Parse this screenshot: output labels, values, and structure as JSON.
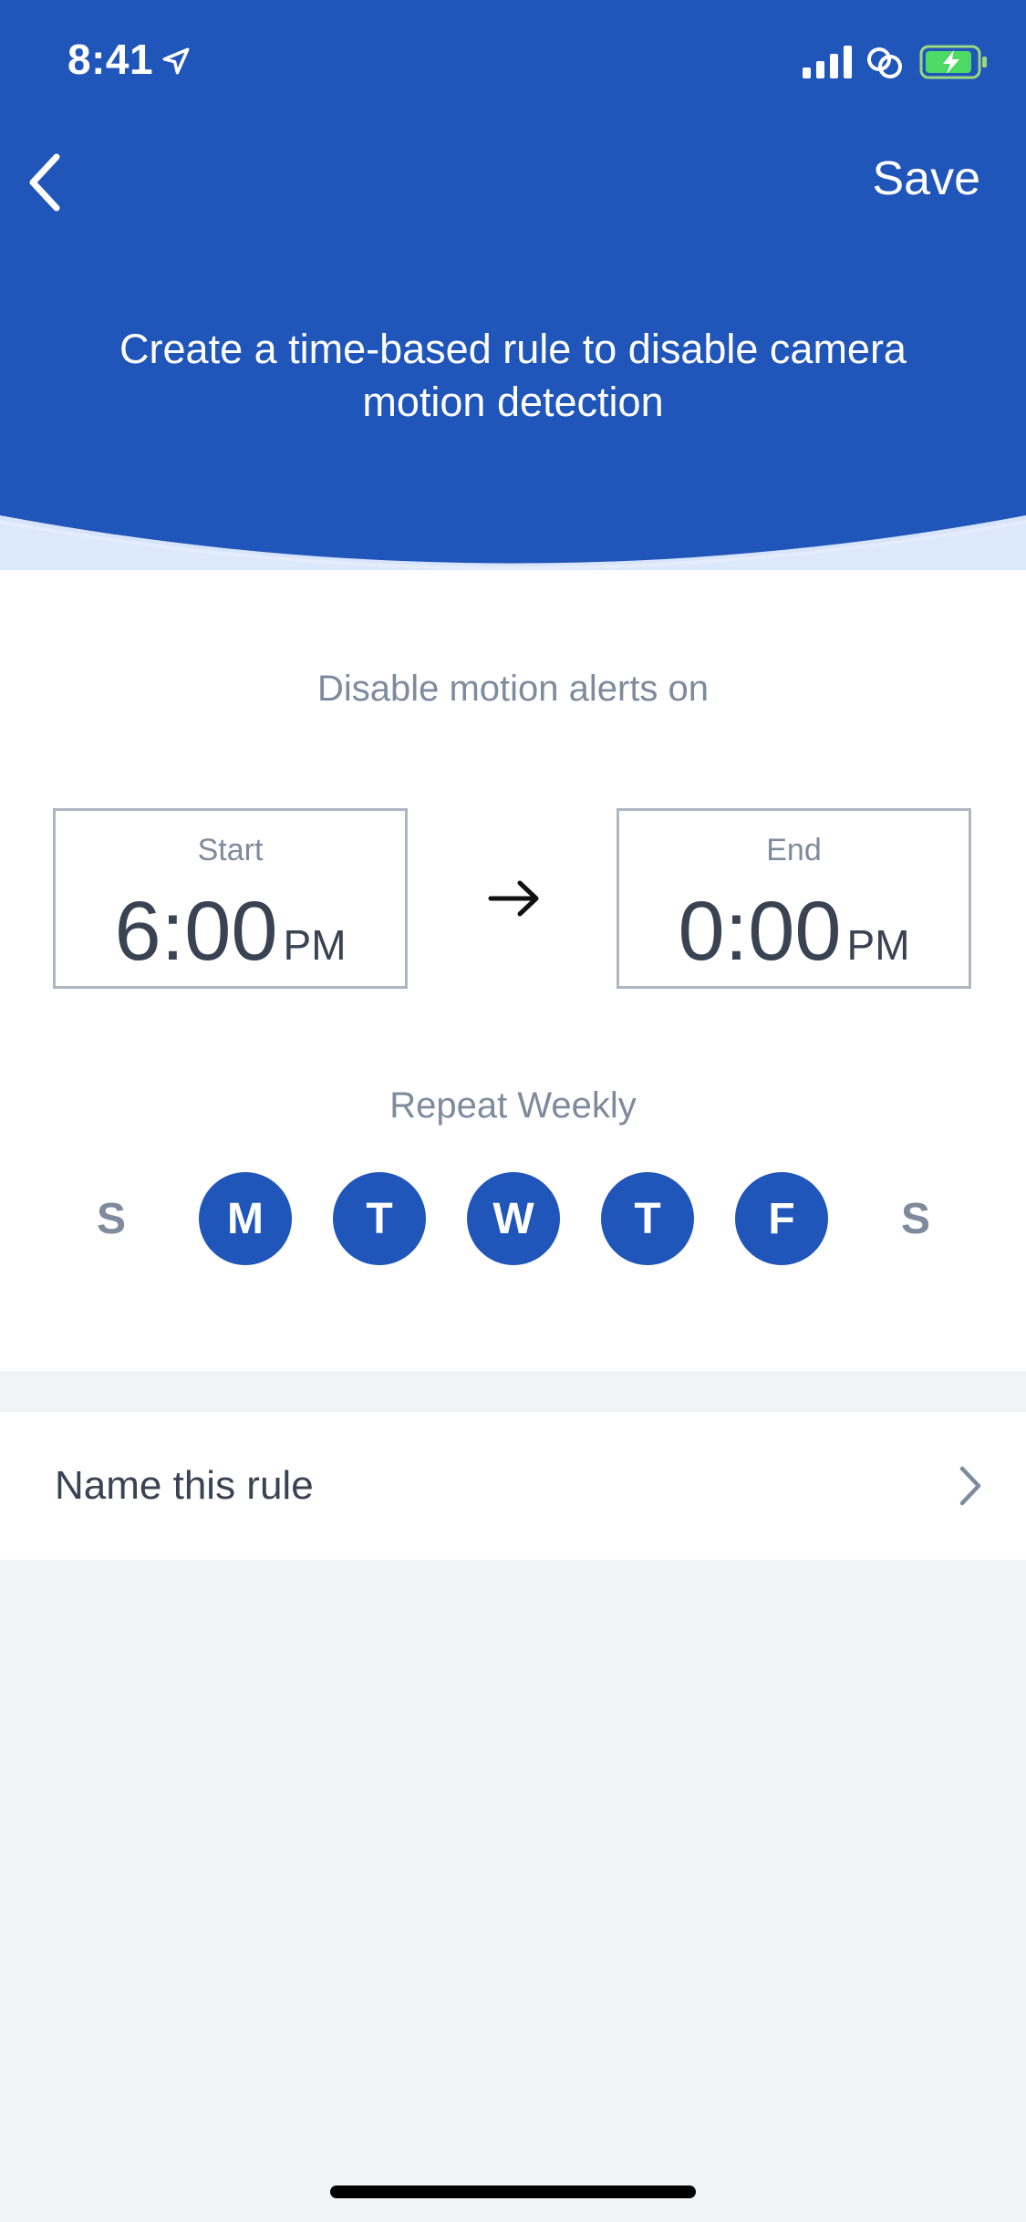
{
  "status_bar": {
    "time": "8:41"
  },
  "header": {
    "save_label": "Save",
    "title": "Create a time-based rule to disable camera motion detection",
    "background_color": "#2055b9"
  },
  "rule": {
    "disable_label": "Disable motion alerts on",
    "start": {
      "label": "Start",
      "time": "6:00",
      "ampm": "PM"
    },
    "end": {
      "label": "End",
      "time": "0:00",
      "ampm": "PM"
    },
    "repeat_label": "Repeat Weekly",
    "days": [
      {
        "label": "S",
        "selected": false
      },
      {
        "label": "M",
        "selected": true
      },
      {
        "label": "T",
        "selected": true
      },
      {
        "label": "W",
        "selected": true
      },
      {
        "label": "T",
        "selected": true
      },
      {
        "label": "F",
        "selected": true
      },
      {
        "label": "S",
        "selected": false
      }
    ]
  },
  "name_row": {
    "label": "Name this rule"
  },
  "icons": {
    "back": "chevron-left-icon",
    "location": "location-arrow-icon",
    "signal": "cellular-signal-icon",
    "link": "link-icon",
    "battery": "battery-charging-icon",
    "arrow": "arrow-right-icon",
    "chevron": "chevron-right-icon"
  }
}
